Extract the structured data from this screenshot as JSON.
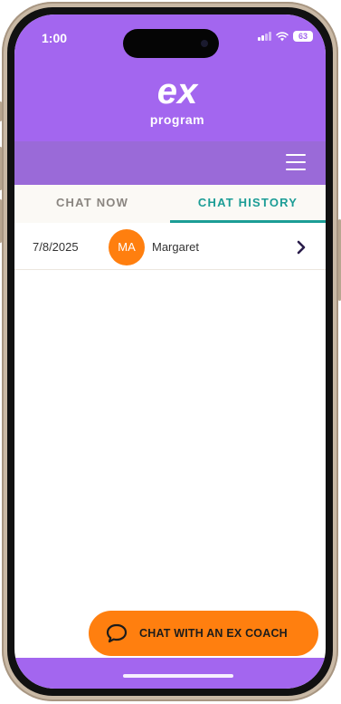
{
  "status_bar": {
    "time": "1:00",
    "battery": "63"
  },
  "logo": {
    "mark": "ex",
    "word": "program"
  },
  "toolbar": {
    "menu_icon": "hamburger-menu-icon"
  },
  "tabs": [
    {
      "label": "CHAT NOW",
      "active": false
    },
    {
      "label": "CHAT HISTORY",
      "active": true
    }
  ],
  "history": [
    {
      "date": "7/8/2025",
      "initials": "MA",
      "name": "Margaret"
    }
  ],
  "cta": {
    "label": "CHAT WITH AN EX COACH",
    "icon": "chat-bubble-icon"
  },
  "colors": {
    "brand_purple": "#a366ef",
    "accent_teal": "#1c9d96",
    "accent_orange": "#ff7f0f"
  }
}
